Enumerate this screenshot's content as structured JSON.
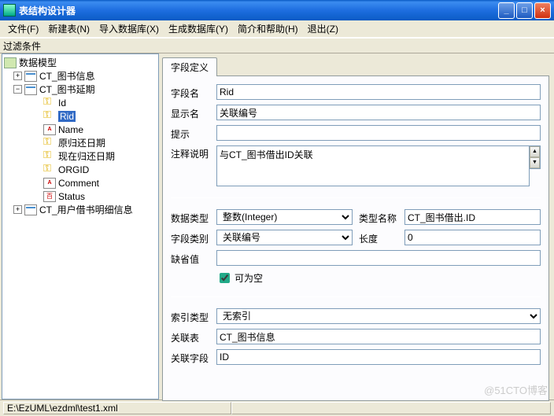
{
  "title": "表结构设计器",
  "menu": {
    "file": "文件(F)",
    "new": "新建表(N)",
    "import": "导入数据库(X)",
    "gen": "生成数据库(Y)",
    "help": "简介和帮助(H)",
    "exit": "退出(Z)"
  },
  "filter_label": "过滤条件",
  "tree": {
    "root": "数据模型",
    "n1": "CT_图书信息",
    "n2": "CT_图书延期",
    "f_id": "Id",
    "f_rid": "Rid",
    "f_name": "Name",
    "f_d1": "原归还日期",
    "f_d2": "现在归还日期",
    "f_org": "ORGID",
    "f_com": "Comment",
    "f_stat": "Status",
    "n3": "CT_用户借书明细信息"
  },
  "tab": "字段定义",
  "labels": {
    "fname": "字段名",
    "dname": "显示名",
    "hint": "提示",
    "note": "注释说明",
    "dtype": "数据类型",
    "tname": "类型名称",
    "fkind": "字段类别",
    "len": "长度",
    "defv": "缺省值",
    "nullable": "可为空",
    "idx": "索引类型",
    "reltbl": "关联表",
    "relfld": "关联字段"
  },
  "values": {
    "fname": "Rid",
    "dname": "关联编号",
    "hint": "",
    "note": "与CT_图书借出ID关联",
    "dtype": "整数(Integer)",
    "tname": "CT_图书借出.ID",
    "fkind": "关联编号",
    "len": "0",
    "defv": "",
    "nullable": true,
    "idx": "无索引",
    "reltbl": "CT_图书信息",
    "relfld": "ID"
  },
  "status": "E:\\EzUML\\ezdml\\test1.xml",
  "watermark": "@51CTO博客"
}
